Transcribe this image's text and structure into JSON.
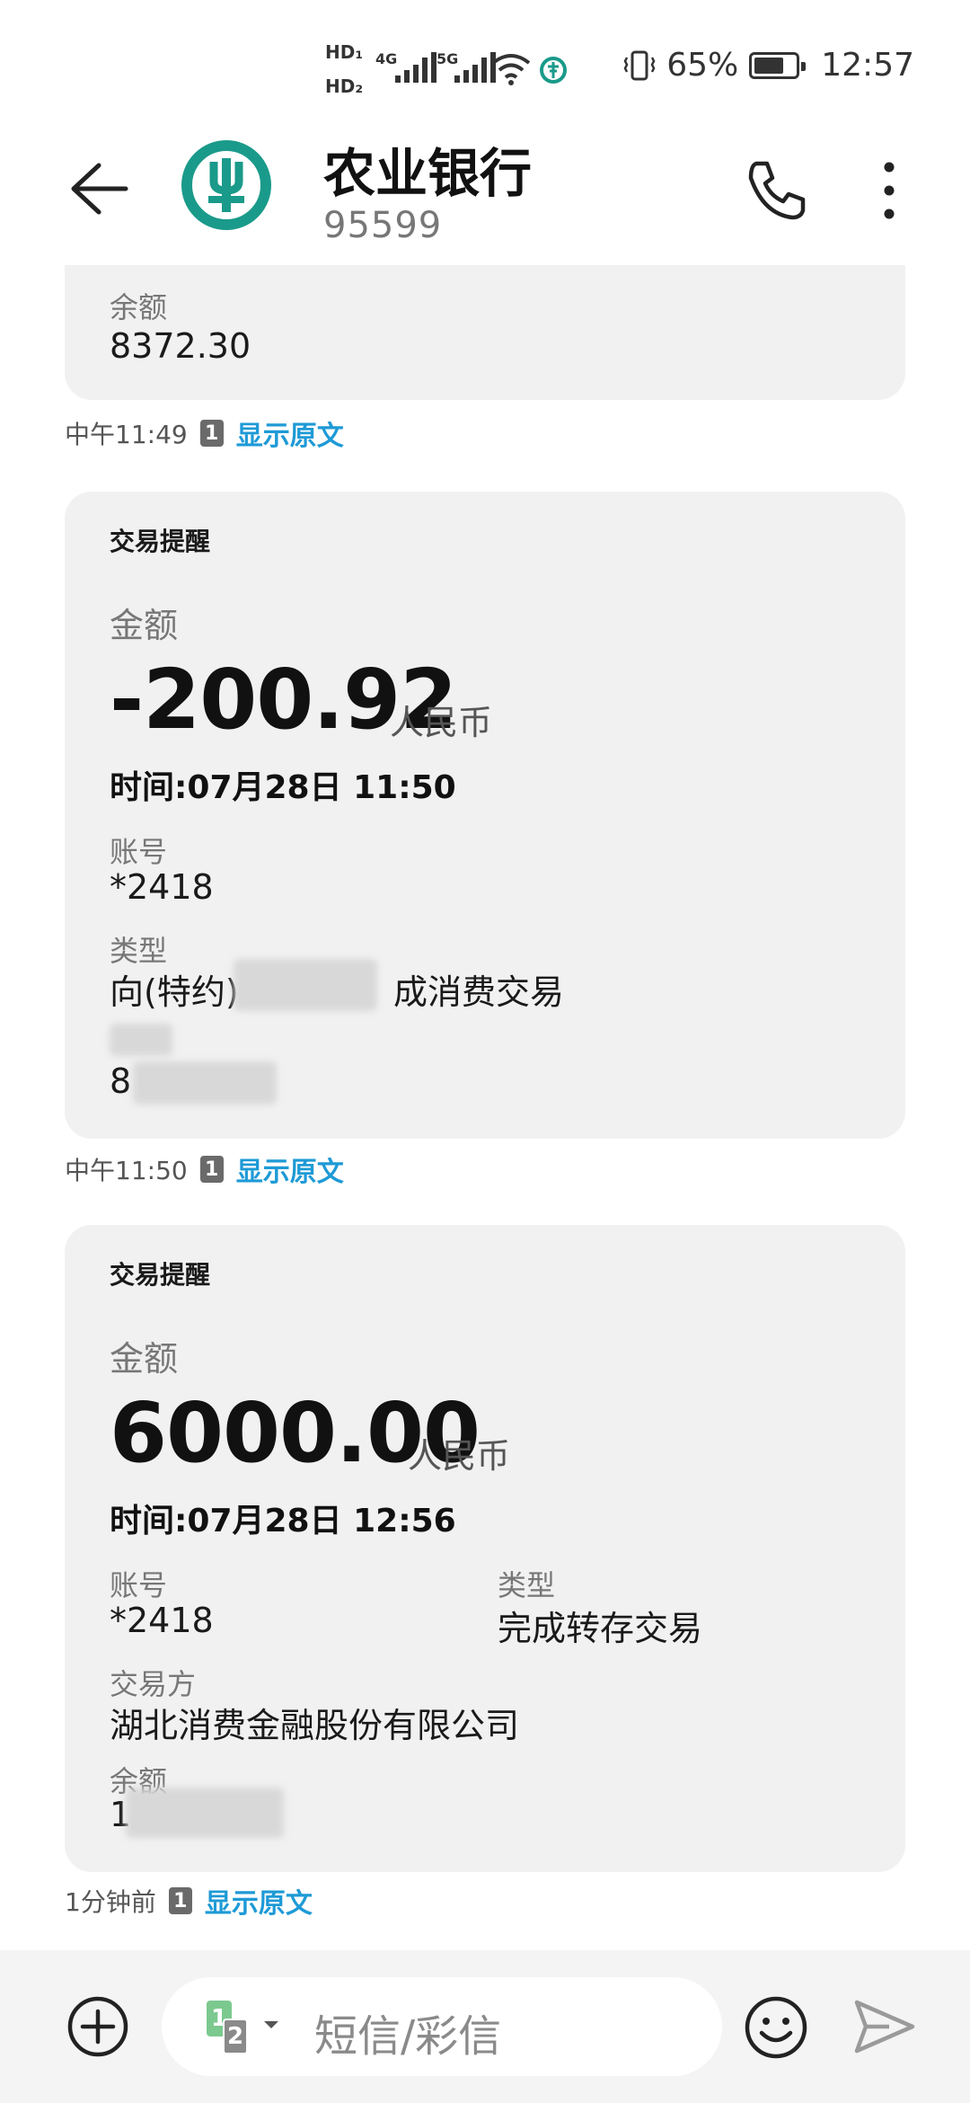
{
  "status_bar": {
    "sim1": "HD₁",
    "sim2": "HD₂",
    "net1": "4G",
    "net2": "5G",
    "battery": "65%",
    "time": "12:57"
  },
  "header": {
    "title": "农业银行",
    "number": "95599"
  },
  "messages": [
    {
      "balance_label": "余额",
      "balance_value": "8372.30",
      "meta_time": "中午11:49",
      "sim": "1",
      "show_original": "显示原文"
    },
    {
      "card_title": "交易提醒",
      "amount_label": "金额",
      "amount": "-200.92",
      "currency": "人民币",
      "time": "时间:07月28日 11:50",
      "account_label": "账号",
      "account_value": "*2418",
      "type_label": "类型",
      "type_value_start": "向(特约)",
      "type_value_end": "成消费交易",
      "balance_value_start": "8",
      "meta_time": "中午11:50",
      "sim": "1",
      "show_original": "显示原文"
    },
    {
      "card_title": "交易提醒",
      "amount_label": "金额",
      "amount": "6000.00",
      "currency": "人民币",
      "time": "时间:07月28日 12:56",
      "account_label": "账号",
      "account_value": "*2418",
      "type_label": "类型",
      "type_value": "完成转存交易",
      "party_label": "交易方",
      "party_value": "湖北消费金融股份有限公司",
      "balance_label": "余额",
      "balance_value_start": "1",
      "meta_time": "1分钟前",
      "sim": "1",
      "show_original": "显示原文"
    }
  ],
  "input_bar": {
    "sim_primary": "1",
    "sim_secondary": "2",
    "placeholder": "短信/彩信"
  },
  "colors": {
    "brand": "#1a9a8a",
    "link": "#1e9ad6",
    "bubble": "#f1f1f1"
  }
}
